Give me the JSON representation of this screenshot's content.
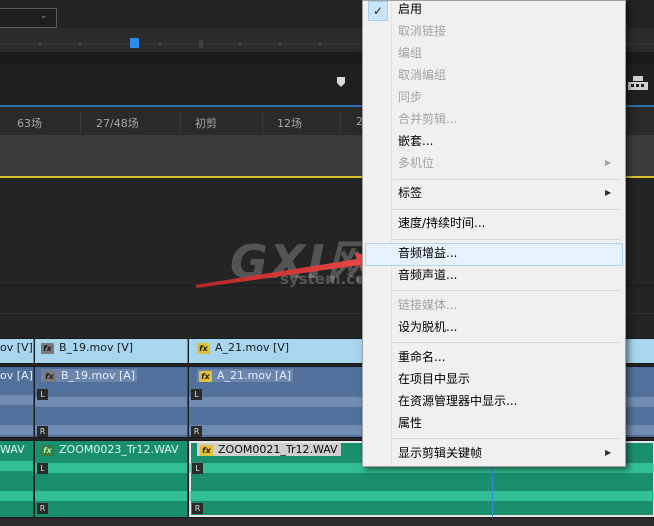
{
  "timeline": {
    "scene_labels": [
      "63场",
      "27/48场",
      "初剪",
      "12场",
      "2"
    ],
    "video_clips": [
      {
        "label": "ov [V]",
        "fx": "none"
      },
      {
        "label": "B_19.mov [V]",
        "fx": "fx"
      },
      {
        "label": "A_21.mov [V]",
        "fx": "fx"
      }
    ],
    "audio_clips": [
      {
        "label": "ov [A]",
        "fx": "none"
      },
      {
        "label": "B_19.mov [A]",
        "fx": "fx"
      },
      {
        "label": "A_21.mov [A]",
        "fx": "fx"
      }
    ],
    "green_clips": [
      {
        "label": "WAV",
        "fx": "none"
      },
      {
        "label": "ZOOM0023_Tr12.WAV",
        "fx": "fx"
      },
      {
        "label": "ZOOM0021_Tr12.WAV",
        "fx": "fx"
      }
    ],
    "channel_left": "L",
    "channel_right": "R"
  },
  "watermark": {
    "text": "GXI网",
    "sub": "system.com"
  },
  "context_menu": {
    "items": [
      {
        "label": "启用",
        "checked": true,
        "disabled": false
      },
      {
        "label": "取消链接",
        "disabled": true
      },
      {
        "label": "编组",
        "disabled": true
      },
      {
        "label": "取消编组",
        "disabled": true
      },
      {
        "label": "同步",
        "disabled": true
      },
      {
        "label": "合并剪辑...",
        "disabled": true
      },
      {
        "label": "嵌套...",
        "disabled": false
      },
      {
        "label": "多机位",
        "disabled": true,
        "submenu": true
      },
      {
        "label": "标签",
        "disabled": false,
        "submenu": true
      },
      {
        "label": "速度/持续时间...",
        "disabled": false
      },
      {
        "label": "音频增益...",
        "disabled": false,
        "highlighted": true
      },
      {
        "label": "音频声道...",
        "disabled": false
      },
      {
        "label": "链接媒体...",
        "disabled": true
      },
      {
        "label": "设为脱机...",
        "disabled": false
      },
      {
        "label": "重命名...",
        "disabled": false
      },
      {
        "label": "在项目中显示",
        "disabled": false
      },
      {
        "label": "在资源管理器中显示...",
        "disabled": false
      },
      {
        "label": "属性",
        "disabled": false
      },
      {
        "label": "显示剪辑关键帧",
        "disabled": false,
        "submenu": true
      }
    ],
    "check_glyph": "✓",
    "submenu_glyph": "▶"
  },
  "colors": {
    "video_clip": "#a9d6ef",
    "audio_clip": "#51709c",
    "green_clip": "#1a8f6e",
    "playhead": "#2d8ceb",
    "arrow": "#e23a3a"
  }
}
